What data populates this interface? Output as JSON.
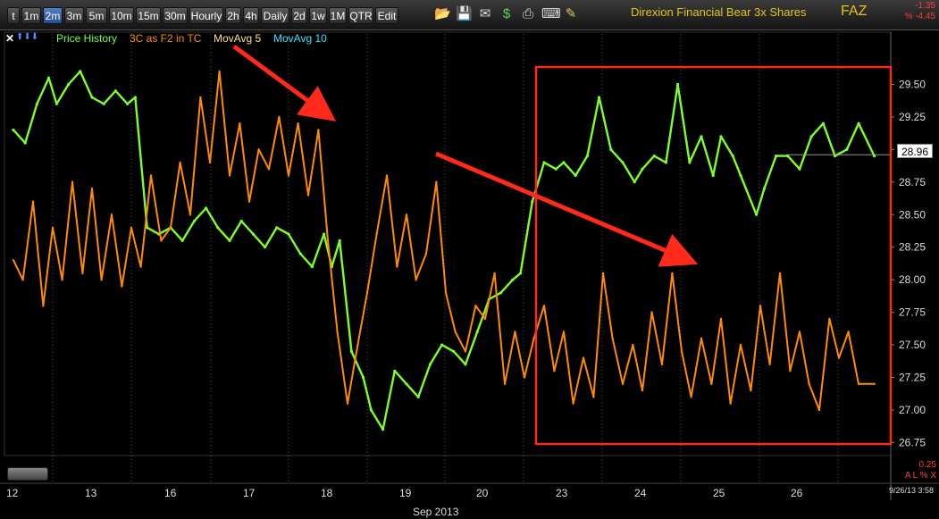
{
  "toolbar": {
    "buttons": [
      {
        "label": "t",
        "active": false
      },
      {
        "label": "1m",
        "active": false
      },
      {
        "label": "2m",
        "active": true
      },
      {
        "label": "3m",
        "active": false
      },
      {
        "label": "5m",
        "active": false
      },
      {
        "label": "10m",
        "active": false
      },
      {
        "label": "15m",
        "active": false
      },
      {
        "label": "30m",
        "active": false
      },
      {
        "label": "Hourly",
        "active": false
      },
      {
        "label": "2h",
        "active": false
      },
      {
        "label": "4h",
        "active": false
      },
      {
        "label": "Daily",
        "active": false
      },
      {
        "label": "2d",
        "active": false
      },
      {
        "label": "1w",
        "active": false
      },
      {
        "label": "1M",
        "active": false
      },
      {
        "label": "QTR",
        "active": false
      },
      {
        "label": "Edit",
        "active": false
      }
    ],
    "icons": [
      "folder-icon",
      "save-icon",
      "email-icon",
      "dollar-icon",
      "print-icon",
      "keyboard-icon",
      "pencil-icon"
    ],
    "title": "Direxion Financial Bear 3x Shares",
    "symbol": "FAZ",
    "change": "-1.35",
    "change_pct": "% -4.45"
  },
  "legend": {
    "close_glyph": "✕",
    "arrows": "⬆⬇⬇",
    "price_history": "Price History",
    "indicator": "3C as F2 in TC",
    "ma5": "MovAvg 5",
    "ma10": "MovAvg 10"
  },
  "colors": {
    "price": "#7cff2c",
    "indicator": "#ff8c00",
    "ma5": "#ffe27a",
    "ma10": "#2ee6ff",
    "annotation": "#ff2a1a",
    "grid": "#555555"
  },
  "footer": {
    "volume_value": "0.25",
    "volume_flags": "A L % X",
    "timestamp": "9/26/13 3:58",
    "current_price": "28.96"
  },
  "chart_data": {
    "type": "line",
    "x_axis_title": "Sep 2013",
    "x_ticks": [
      "12",
      "13",
      "16",
      "17",
      "18",
      "19",
      "20",
      "23",
      "24",
      "25",
      "26"
    ],
    "y_ticks": [
      "29.50",
      "29.25",
      "29.00",
      "28.75",
      "28.50",
      "28.25",
      "28.00",
      "27.75",
      "27.50",
      "27.25",
      "27.00",
      "26.75"
    ],
    "ylim": [
      26.65,
      29.75
    ],
    "grid": "dotted vertical at day boundaries",
    "series": [
      {
        "name": "Price History",
        "note_color": "green",
        "x": [
          0,
          0.15,
          0.3,
          0.45,
          0.55,
          0.7,
          0.85,
          1.0,
          1.15,
          1.3,
          1.45,
          1.55,
          1.7,
          1.85,
          2.0,
          2.15,
          2.3,
          2.45,
          2.6,
          2.75,
          2.9,
          3.05,
          3.2,
          3.35,
          3.5,
          3.65,
          3.8,
          3.95,
          4.05,
          4.15,
          4.3,
          4.45,
          4.55,
          4.7,
          4.85,
          5.0,
          5.15,
          5.3,
          5.45,
          5.6,
          5.75,
          5.9,
          6.05,
          6.2,
          6.35,
          6.45,
          6.6,
          6.75,
          6.9,
          7.0,
          7.15,
          7.3,
          7.45,
          7.6,
          7.75,
          7.9,
          8.0,
          8.15,
          8.3,
          8.45,
          8.6,
          8.75,
          8.9,
          9.0,
          9.15,
          9.25,
          9.45,
          9.55,
          9.7,
          9.85,
          10.0,
          10.15,
          10.3,
          10.45,
          10.6,
          10.75,
          10.95
        ],
        "values": [
          29.15,
          29.05,
          29.35,
          29.55,
          29.35,
          29.5,
          29.6,
          29.4,
          29.35,
          29.45,
          29.35,
          29.4,
          28.4,
          28.35,
          28.4,
          28.3,
          28.45,
          28.55,
          28.4,
          28.3,
          28.45,
          28.35,
          28.25,
          28.4,
          28.35,
          28.2,
          28.1,
          28.35,
          28.1,
          28.3,
          27.45,
          27.25,
          27.0,
          26.85,
          27.3,
          27.2,
          27.1,
          27.35,
          27.5,
          27.45,
          27.35,
          27.6,
          27.85,
          27.9,
          28.0,
          28.05,
          28.6,
          28.9,
          28.85,
          28.9,
          28.8,
          28.95,
          29.4,
          29.0,
          28.9,
          28.75,
          28.85,
          28.95,
          28.9,
          29.5,
          28.9,
          29.1,
          28.8,
          29.1,
          28.95,
          28.8,
          28.5,
          28.7,
          28.95,
          28.95,
          28.85,
          29.1,
          29.2,
          28.95,
          29.0,
          29.2,
          28.95
        ]
      },
      {
        "name": "3C as F2 in TC",
        "note_color": "orange",
        "x": [
          0,
          0.12,
          0.25,
          0.38,
          0.5,
          0.62,
          0.75,
          0.88,
          1.0,
          1.12,
          1.25,
          1.38,
          1.5,
          1.62,
          1.75,
          1.88,
          2.0,
          2.12,
          2.25,
          2.38,
          2.5,
          2.62,
          2.75,
          2.88,
          3.0,
          3.12,
          3.25,
          3.38,
          3.5,
          3.62,
          3.75,
          3.88,
          4.0,
          4.12,
          4.25,
          4.38,
          4.5,
          4.62,
          4.75,
          4.88,
          5.0,
          5.12,
          5.25,
          5.38,
          5.5,
          5.62,
          5.75,
          5.88,
          6.0,
          6.12,
          6.25,
          6.38,
          6.5,
          6.62,
          6.75,
          6.88,
          7.0,
          7.12,
          7.25,
          7.38,
          7.5,
          7.62,
          7.75,
          7.88,
          8.0,
          8.12,
          8.25,
          8.38,
          8.5,
          8.62,
          8.75,
          8.88,
          9.0,
          9.12,
          9.25,
          9.38,
          9.5,
          9.62,
          9.75,
          9.88,
          10.0,
          10.12,
          10.25,
          10.38,
          10.5,
          10.62,
          10.75,
          10.95
        ],
        "values": [
          28.15,
          28.0,
          28.6,
          27.8,
          28.4,
          28.0,
          28.75,
          28.05,
          28.7,
          28.0,
          28.5,
          27.95,
          28.4,
          28.1,
          28.8,
          28.3,
          28.4,
          28.9,
          28.5,
          29.4,
          28.9,
          29.6,
          28.8,
          29.2,
          28.6,
          29.0,
          28.85,
          29.25,
          28.8,
          29.2,
          28.65,
          29.15,
          28.3,
          27.6,
          27.05,
          27.5,
          27.9,
          28.35,
          28.8,
          28.1,
          28.5,
          28.0,
          28.2,
          28.75,
          27.9,
          27.6,
          27.45,
          27.8,
          27.7,
          28.05,
          27.2,
          27.6,
          27.25,
          27.55,
          27.8,
          27.3,
          27.6,
          27.05,
          27.4,
          27.1,
          28.05,
          27.55,
          27.2,
          27.5,
          27.15,
          27.75,
          27.35,
          28.05,
          27.45,
          27.1,
          27.55,
          27.2,
          27.7,
          27.05,
          27.5,
          27.15,
          27.8,
          27.35,
          28.05,
          27.3,
          27.6,
          27.2,
          27.0,
          27.7,
          27.4,
          27.6,
          27.2,
          27.2
        ]
      }
    ]
  }
}
